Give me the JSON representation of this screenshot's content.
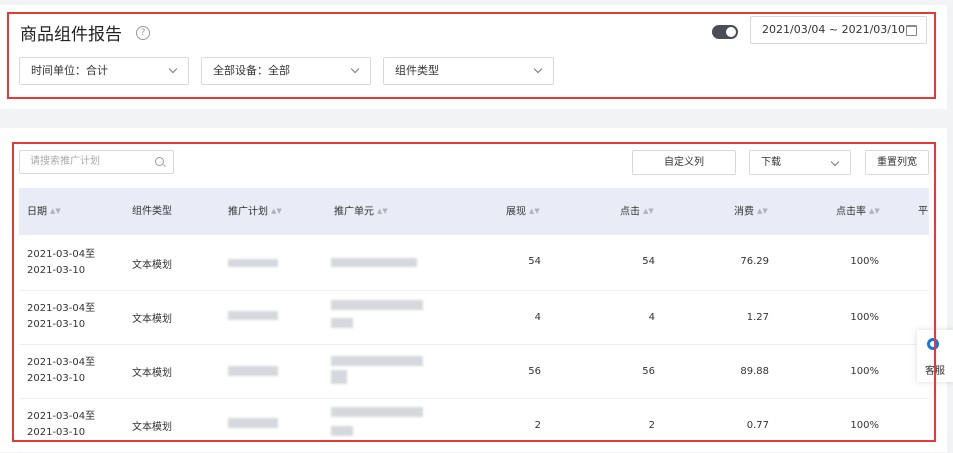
{
  "header": {
    "title": "商品组件报告",
    "help_icon": "question-circle-icon",
    "date_range": "2021/03/04 ~ 2021/03/10",
    "filters": [
      "时间单位：合计",
      "全部设备：全部",
      "组件类型"
    ]
  },
  "toolbar": {
    "search_placeholder": "请搜索推广计划",
    "custom_columns_label": "自定义列",
    "download_label": "下载",
    "reset_width_label": "重置列宽"
  },
  "table": {
    "columns": [
      "日期",
      "组件类型",
      "推广计划",
      "推广单元",
      "展现",
      "点击",
      "消费",
      "点击率",
      "平"
    ],
    "rows": [
      {
        "date": "2021-03-04至2021-03-10",
        "type": "文本模划",
        "impressions": "54",
        "clicks": "54",
        "cost": "76.29",
        "ctr": "100%"
      },
      {
        "date": "2021-03-04至2021-03-10",
        "type": "文本模划",
        "impressions": "4",
        "clicks": "4",
        "cost": "1.27",
        "ctr": "100%"
      },
      {
        "date": "2021-03-04至2021-03-10",
        "type": "文本模划",
        "impressions": "56",
        "clicks": "56",
        "cost": "89.88",
        "ctr": "100%"
      },
      {
        "date": "2021-03-04至2021-03-10",
        "type": "文本模划",
        "impressions": "2",
        "clicks": "2",
        "cost": "0.77",
        "ctr": "100%"
      }
    ]
  },
  "sidebar": {
    "label": "客服",
    "icon": "headset-icon"
  },
  "colors": {
    "highlight_border": "#e53935",
    "table_header_bg": "#e9ecf6",
    "accent": "#1e6fe0"
  }
}
